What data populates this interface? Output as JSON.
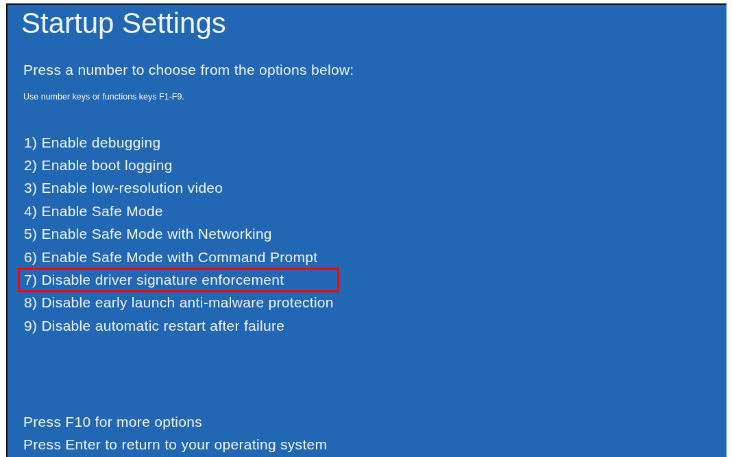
{
  "title": "Startup Settings",
  "prompt": "Press a number to choose from the options below:",
  "hint": "Use number keys or functions keys F1-F9.",
  "options": [
    {
      "label": "1) Enable debugging",
      "highlighted": false
    },
    {
      "label": "2) Enable boot logging",
      "highlighted": false
    },
    {
      "label": "3) Enable low-resolution video",
      "highlighted": false
    },
    {
      "label": "4) Enable Safe Mode",
      "highlighted": false
    },
    {
      "label": "5) Enable Safe Mode with Networking",
      "highlighted": false
    },
    {
      "label": "6) Enable Safe Mode with Command Prompt",
      "highlighted": false
    },
    {
      "label": "7) Disable driver signature enforcement",
      "highlighted": true
    },
    {
      "label": "8) Disable early launch anti-malware protection",
      "highlighted": false
    },
    {
      "label": "9) Disable automatic restart after failure",
      "highlighted": false
    }
  ],
  "footer": [
    "Press F10 for more options",
    "Press Enter to return to your operating system"
  ]
}
